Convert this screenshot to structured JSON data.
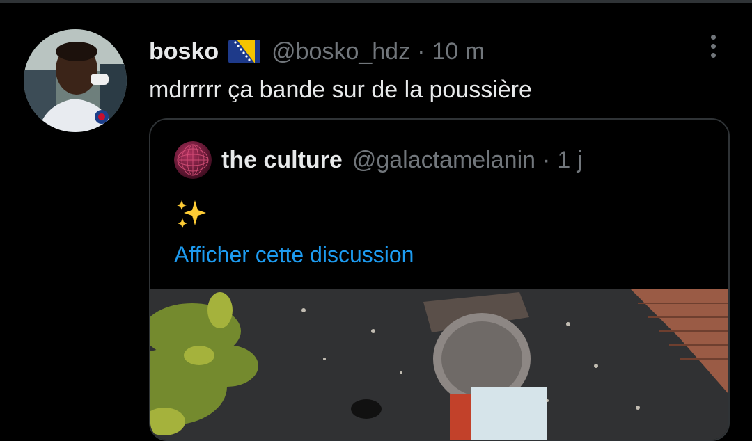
{
  "tweet": {
    "display_name": "bosko",
    "handle": "@bosko_hdz",
    "separator": "·",
    "time": "10 m",
    "text": "mdrrrrr ça bande sur de la poussière",
    "flag": "bosnia-flag-emoji"
  },
  "quoted_tweet": {
    "display_name": "the culture",
    "handle": "@galactamelanin",
    "separator": "·",
    "time": "1 j",
    "emoji": "sparkles-emoji",
    "show_thread_label": "Afficher cette discussion"
  },
  "colors": {
    "background": "#000000",
    "primary_text": "#e7e9ea",
    "secondary_text": "#71767b",
    "link": "#1d9bf0",
    "border": "#2f3336"
  },
  "icons": [
    "more-options-icon"
  ]
}
